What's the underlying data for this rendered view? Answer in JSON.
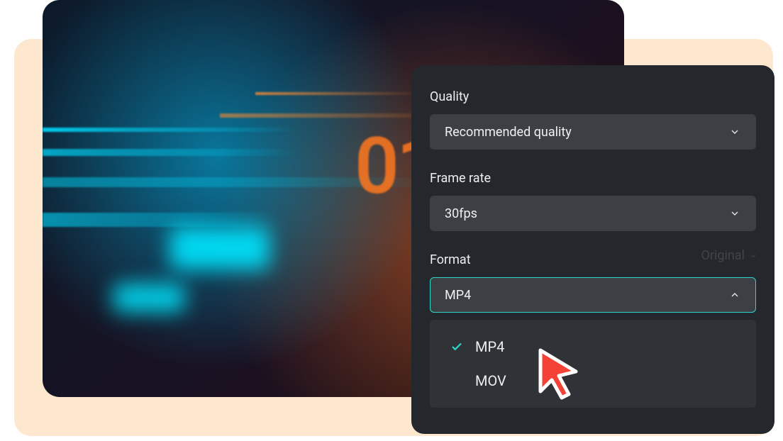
{
  "panel": {
    "quality": {
      "label": "Quality",
      "value": "Recommended quality"
    },
    "framerate": {
      "label": "Frame rate",
      "value": "30fps"
    },
    "format": {
      "label": "Format",
      "value": "MP4",
      "options": [
        "MP4",
        "MOV"
      ],
      "selected_index": 0
    }
  },
  "ghost_text": "Original",
  "colors": {
    "panel_bg": "#24272b",
    "select_bg": "#3c3f43",
    "accent": "#2fd6c7",
    "backdrop": "#fde8cf",
    "cursor": "#f44336"
  }
}
